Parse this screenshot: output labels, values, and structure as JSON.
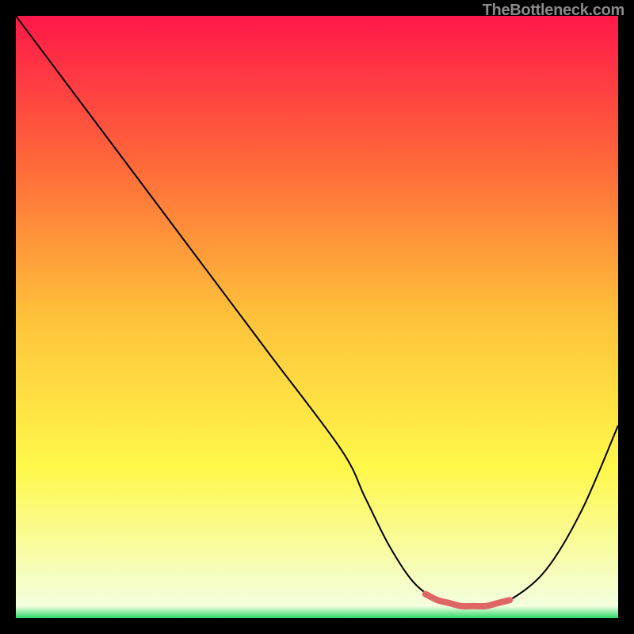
{
  "watermark": "TheBottleneck.com",
  "chart_data": {
    "type": "line",
    "title": "",
    "xlabel": "",
    "ylabel": "",
    "xlim": [
      0,
      100
    ],
    "ylim": [
      0,
      100
    ],
    "grid": false,
    "legend": false,
    "series": [
      {
        "name": "bottleneck-curve",
        "color": "#000000",
        "x": [
          0,
          6,
          18,
          30,
          42,
          54,
          58,
          62,
          66,
          70,
          74,
          78,
          82,
          88,
          94,
          100
        ],
        "values": [
          100,
          92,
          76,
          60,
          44,
          28,
          20,
          12,
          6,
          3,
          2,
          2,
          3,
          8,
          18,
          32
        ]
      },
      {
        "name": "optimal-range-highlight",
        "color": "#e06666",
        "x": [
          68,
          70,
          72,
          74,
          76,
          78,
          80,
          82
        ],
        "values": [
          4,
          3,
          2.5,
          2,
          2,
          2,
          2.5,
          3
        ]
      }
    ],
    "background_gradient": {
      "stops": [
        {
          "offset": 0.0,
          "color": "#ff1849"
        },
        {
          "offset": 0.25,
          "color": "#ff6a3a"
        },
        {
          "offset": 0.5,
          "color": "#ffc23a"
        },
        {
          "offset": 0.75,
          "color": "#fff84a"
        },
        {
          "offset": 0.98,
          "color": "#f4ffdf"
        },
        {
          "offset": 1.0,
          "color": "#2bd96a"
        }
      ]
    },
    "annotations": []
  }
}
